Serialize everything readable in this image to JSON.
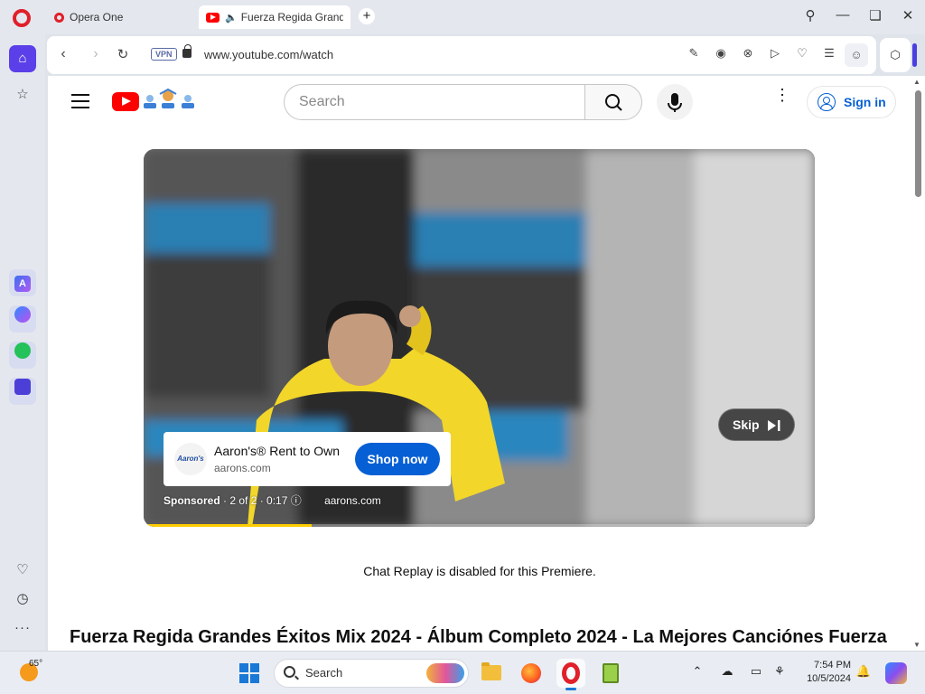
{
  "browser": {
    "tabs": [
      {
        "label": "Opera One",
        "active": false
      },
      {
        "label": "Fuerza Regida Grandes",
        "active": true
      }
    ],
    "new_tab_symbol": "+",
    "address": {
      "vpn_label": "VPN",
      "url": "www.youtube.com/watch"
    },
    "toolbar_icons": [
      "snapshot-edit-icon",
      "camera-icon",
      "adblock-icon",
      "flow-icon",
      "heart-icon",
      "easy-setup-icon",
      "profile-icon",
      "extensions-icon"
    ]
  },
  "sidebar": {
    "items": [
      "home-icon",
      "bookmarks-star-icon",
      "aria-icon",
      "messenger-icon",
      "whatsapp-icon",
      "music-player-icon",
      "heart-icon",
      "history-clock-icon",
      "more-icon"
    ]
  },
  "youtube": {
    "search_placeholder": "Search",
    "sign_in_label": "Sign in",
    "ad": {
      "logo_text": "Aaron's",
      "title": "Aaron's® Rent to Own",
      "domain": "aarons.com",
      "cta_label": "Shop now",
      "sponsored_label": "Sponsored",
      "sponsored_detail": "· 2 of 2 · 0:17 ⓘ",
      "sponsored_domain": "aarons.com",
      "skip_label": "Skip",
      "progress_fraction": 0.25
    },
    "chat_note": "Chat Replay is disabled for this Premiere.",
    "video_title": "Fuerza Regida Grandes Éxitos Mix 2024 - Álbum Completo 2024 - La Mejores Canciónes Fuerza"
  },
  "taskbar": {
    "weather_temp": "65°",
    "search_label": "Search",
    "apps": [
      "file-explorer-icon",
      "firefox-icon",
      "opera-icon",
      "notepad-plus-icon"
    ],
    "tray_icons": [
      "chevron-up-icon",
      "cloud-off-icon",
      "display-icon",
      "ease-of-access-icon",
      "bell-icon"
    ],
    "time": "7:54 PM",
    "date": "10/5/2024"
  },
  "colors": {
    "opera_red": "#e0202a",
    "opera_purple": "#5b3fe8",
    "youtube_red": "#ff0000",
    "youtube_blue": "#065fd4",
    "hoodie_yellow": "#f2d62a"
  }
}
